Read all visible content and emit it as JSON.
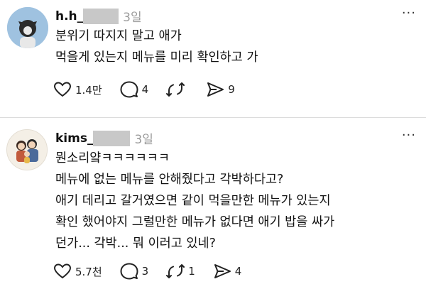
{
  "posts": [
    {
      "username": "h.h_",
      "time": "3일",
      "more": "···",
      "lines": [
        "분위기 따지지 말고 애가",
        "먹을게 있는지 메뉴를 미리 확인하고 가"
      ],
      "likes": "1.4만",
      "comments": "4",
      "reposts": "",
      "shares": "9"
    },
    {
      "username": "kims_",
      "time": "3일",
      "more": "···",
      "lines": [
        "뭔소리얔ㅋㅋㅋㅋㅋㅋ",
        "메뉴에 없는 메뉴를 안해줬다고 각박하다고?",
        "애기 데리고 갈거였으면 같이 먹을만한 메뉴가 있는지",
        "확인 했어야지 그럴만한 메뉴가 없다면 애기 밥을 싸가",
        "던가... 각박... 뭐 이러고 있네?"
      ],
      "likes": "5.7천",
      "comments": "3",
      "reposts": "1",
      "shares": "4"
    }
  ],
  "icons": {
    "like": "heart-icon",
    "comment": "comment-icon",
    "repost": "repost-icon",
    "share": "share-icon"
  }
}
